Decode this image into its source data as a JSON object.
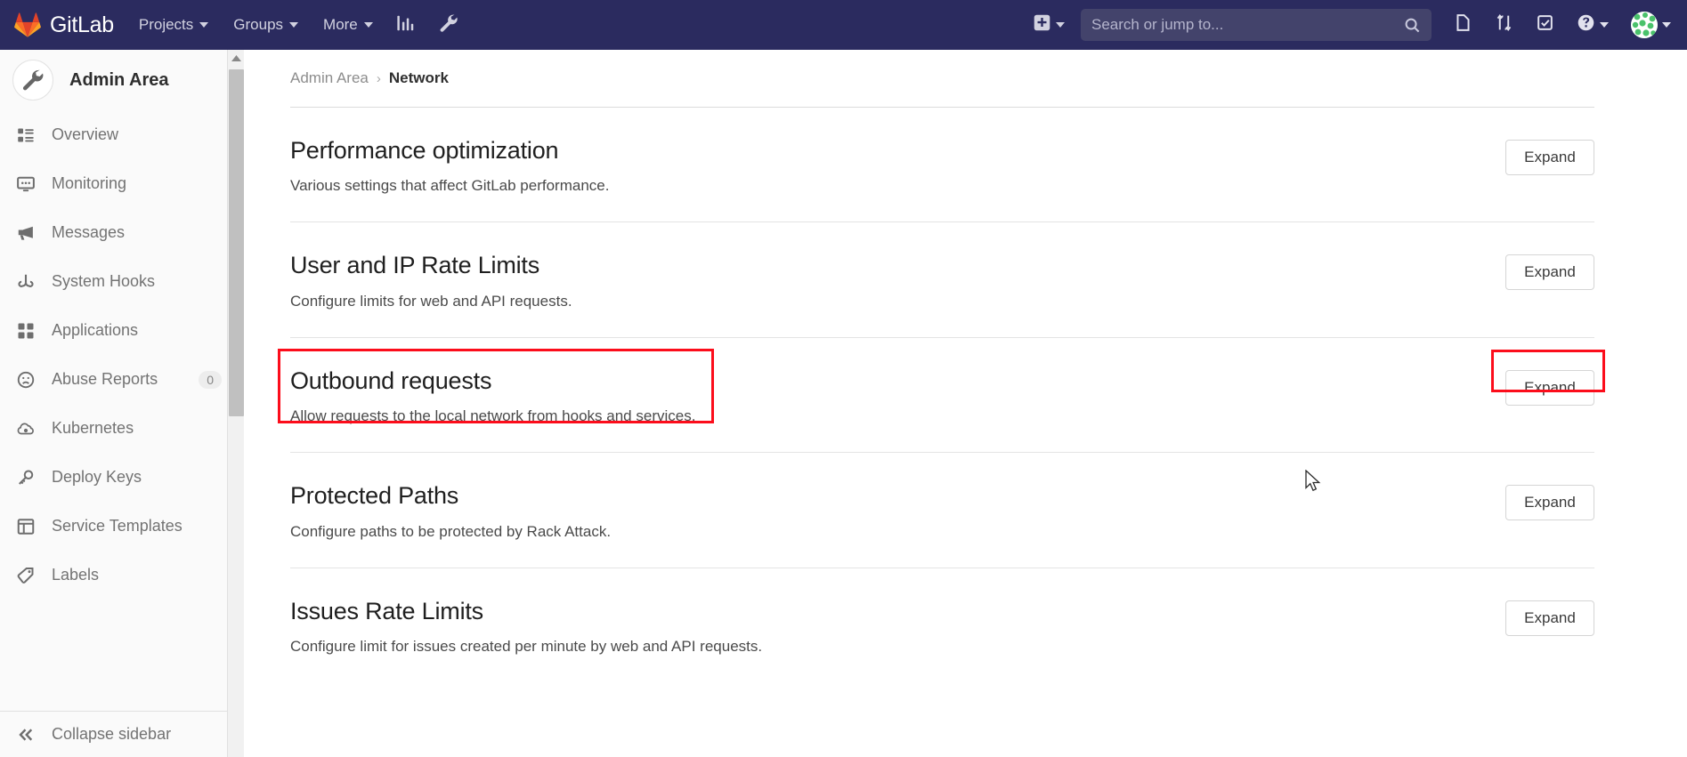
{
  "navbar": {
    "brand": "GitLab",
    "brand_logo_icon": "gitlab-fox-logo",
    "links": [
      {
        "label": "Projects",
        "icon": "chevron-down-icon"
      },
      {
        "label": "Groups",
        "icon": "chevron-down-icon"
      },
      {
        "label": "More",
        "icon": "chevron-down-icon"
      }
    ],
    "analytics_icon": "bar-chart-icon",
    "admin_icon": "wrench-icon",
    "plus_icon": "plus-square-icon",
    "search": {
      "placeholder": "Search or jump to...",
      "value": "",
      "icon": "search-icon"
    },
    "tools": [
      {
        "name": "snippets",
        "icon": "document-icon"
      },
      {
        "name": "merge-requests",
        "icon": "merge-request-icon"
      },
      {
        "name": "todos",
        "icon": "check-square-icon"
      },
      {
        "name": "help",
        "icon": "question-circle-icon"
      }
    ],
    "avatar_icon": "user-avatar",
    "colors": {
      "background": "#2b2b5f",
      "search_bg": "#43436b"
    }
  },
  "sidebar": {
    "title": "Admin Area",
    "title_icon": "wrench-icon",
    "items": [
      {
        "label": "Overview",
        "icon": "overview-list-icon",
        "badge": ""
      },
      {
        "label": "Monitoring",
        "icon": "monitor-icon",
        "badge": ""
      },
      {
        "label": "Messages",
        "icon": "megaphone-icon",
        "badge": ""
      },
      {
        "label": "System Hooks",
        "icon": "hook-icon",
        "badge": ""
      },
      {
        "label": "Applications",
        "icon": "applications-grid-icon",
        "badge": ""
      },
      {
        "label": "Abuse Reports",
        "icon": "sad-face-icon",
        "badge": "0"
      },
      {
        "label": "Kubernetes",
        "icon": "kubernetes-cloud-icon",
        "badge": ""
      },
      {
        "label": "Deploy Keys",
        "icon": "key-icon",
        "badge": ""
      },
      {
        "label": "Service Templates",
        "icon": "template-layout-icon",
        "badge": ""
      },
      {
        "label": "Labels",
        "icon": "label-tag-icon",
        "badge": ""
      }
    ],
    "collapse": {
      "label": "Collapse sidebar",
      "icon": "double-chevron-left-icon"
    }
  },
  "breadcrumb": {
    "root": "Admin Area",
    "separator": "›",
    "current": "Network"
  },
  "main": {
    "sections": [
      {
        "title": "Performance optimization",
        "description": "Various settings that affect GitLab performance.",
        "button": "Expand",
        "highlighted": false
      },
      {
        "title": "User and IP Rate Limits",
        "description": "Configure limits for web and API requests.",
        "button": "Expand",
        "highlighted": false
      },
      {
        "title": "Outbound requests",
        "description": "Allow requests to the local network from hooks and services.",
        "button": "Expand",
        "highlighted": true
      },
      {
        "title": "Protected Paths",
        "description": "Configure paths to be protected by Rack Attack.",
        "button": "Expand",
        "highlighted": false
      },
      {
        "title": "Issues Rate Limits",
        "description": "Configure limit for issues created per minute by web and API requests.",
        "button": "Expand",
        "highlighted": false
      }
    ]
  },
  "annotation": {
    "color": "#fc0d1b"
  },
  "cursor": {
    "icon": "mouse-pointer-arrow"
  }
}
